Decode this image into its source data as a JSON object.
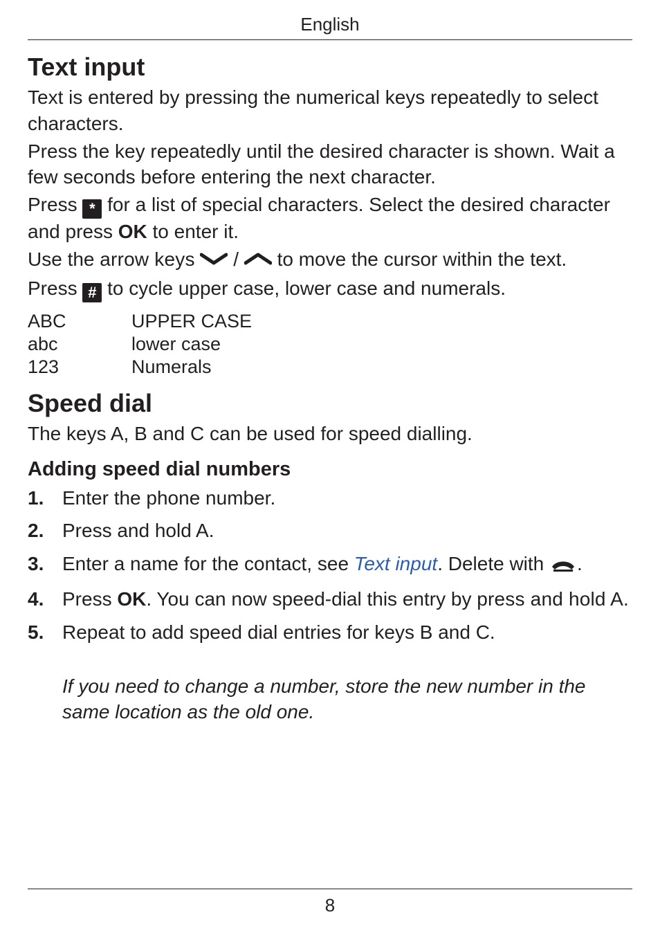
{
  "header_language": "English",
  "page_number": "8",
  "text_input": {
    "heading": "Text input",
    "p1": "Text is entered by pressing the numerical keys repeatedly to select characters.",
    "p2": "Press the key repeatedly until the desired character is shown. Wait a few seconds before entering the next character.",
    "p3a": "Press ",
    "p3b": " for a list of special characters. Select the desired cha­racter and press ",
    "ok_label": "OK",
    "p3c": " to enter it.",
    "p4a": "Use the ",
    "arrow_keys_label": "arrow keys",
    "p4b": " / ",
    "p4c": " to move the cursor within the text.",
    "p5a": "Press ",
    "p5b": " to cycle upper case, lower case and numerals.",
    "star_icon_label": "*",
    "hash_icon_label": "#",
    "case_table": [
      {
        "mode": "ABC",
        "desc": "UPPER CASE"
      },
      {
        "mode": "abc",
        "desc": "lower case"
      },
      {
        "mode": "123",
        "desc": "Numerals"
      }
    ]
  },
  "speed_dial": {
    "heading": "Speed dial",
    "intro": "The keys A, B and C can be used for speed dialling.",
    "sub_heading": "Adding speed dial numbers",
    "steps": {
      "s1": "Enter the phone number.",
      "s2": "Press and hold A.",
      "s3a": "Enter a name for the contact, see ",
      "s3_link": "Text input",
      "s3b": ". Delete with ",
      "s3c": ".",
      "s4a": "Press ",
      "s4b": ". You can now speed-dial this entry by ",
      "s4_press_hold": "press and hold A",
      "s4c": ".",
      "s5": "Repeat to add speed dial entries for keys B and C."
    },
    "note": "If you need to change a number, store the new number in the same location as the old one."
  }
}
